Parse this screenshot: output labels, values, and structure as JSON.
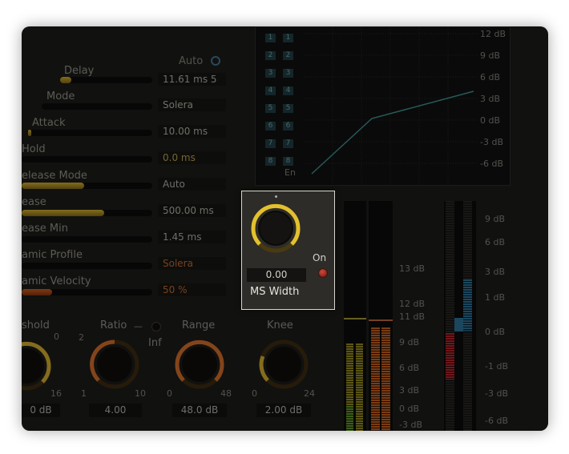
{
  "controls": {
    "auto_label": "Auto",
    "delay": {
      "label": "Delay",
      "value": "11.61 ms 5",
      "level": 0.05
    },
    "mode": {
      "label": "Mode",
      "value": "Solera"
    },
    "attack": {
      "label": "Attack",
      "value": "10.00 ms",
      "level": 0.02
    },
    "hold": {
      "label": "Hold",
      "value": "0.0 ms",
      "level": 0.0
    },
    "release_mode": {
      "label": "elease Mode",
      "value": "Auto",
      "level": 0.45
    },
    "release": {
      "label": "ease",
      "value": "500.00 ms",
      "level": 0.6
    },
    "release_min": {
      "label": "ease Min",
      "value": "1.45 ms",
      "level": 0.0
    },
    "dynamic_profile": {
      "label": "amic Profile",
      "value": "Solera"
    },
    "dynamic_velocity": {
      "label": "amic Velocity",
      "value": "50 %",
      "level": 0.3
    }
  },
  "graph": {
    "channels": [
      "1",
      "2",
      "3",
      "4",
      "5",
      "6",
      "7",
      "8"
    ],
    "en_label": "En",
    "db_labels": [
      "12 dB",
      "9 dB",
      "6 dB",
      "3 dB",
      "0 dB",
      "-3 dB",
      "-6 dB"
    ]
  },
  "ms_width": {
    "value": "0.00",
    "label": "MS Width",
    "on_label": "On"
  },
  "bottom_knobs": {
    "threshold": {
      "label": "shold",
      "scale_top": "0",
      "scale_right": "16",
      "value": "0 dB"
    },
    "ratio": {
      "label": "Ratio",
      "inf_label": "Inf",
      "scale_left_top": "2",
      "scale_left": "1",
      "scale_right": "10",
      "value": "4.00"
    },
    "range": {
      "label": "Range",
      "scale_left": "0",
      "scale_right": "48",
      "value": "48.0 dB"
    },
    "knee": {
      "label": "Knee",
      "scale_left": "0",
      "scale_right": "24",
      "value": "2.00 dB"
    }
  },
  "meters": {
    "left_scale": [
      "13 dB",
      "12 dB",
      "11 dB",
      "9 dB",
      "6 dB",
      "3 dB",
      "0 dB",
      "-3 dB"
    ],
    "right_scale": [
      "9 dB",
      "6 dB",
      "3 dB",
      "1 dB",
      "0 dB",
      "-1 dB",
      "-3 dB",
      "-6 dB"
    ]
  },
  "colors": {
    "accent": "#d8b42a",
    "panel": "#1b1a17",
    "curve": "#3a8a84",
    "orange": "#c4571f"
  }
}
